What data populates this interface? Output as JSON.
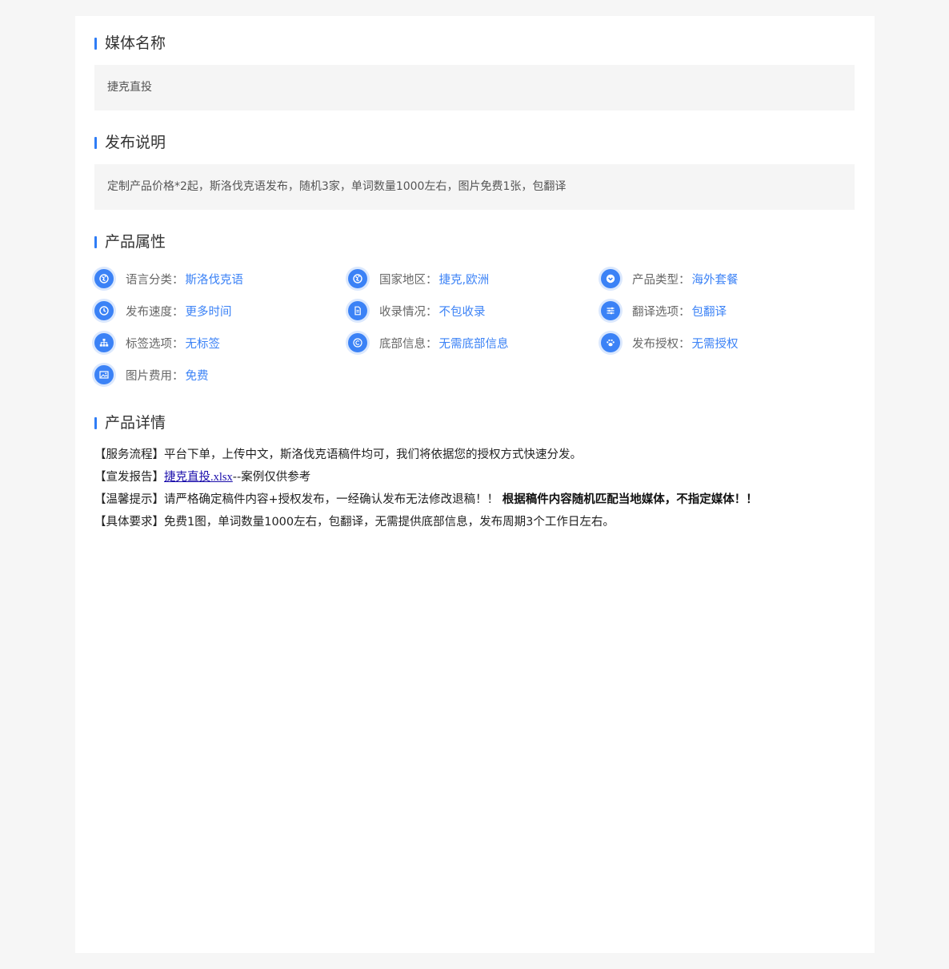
{
  "media_name": {
    "title": "媒体名称",
    "value": "捷克直投"
  },
  "publish_note": {
    "title": "发布说明",
    "value": "定制产品价格*2起，斯洛伐克语发布，随机3家，单词数量1000左右，图片免费1张，包翻译"
  },
  "attributes": {
    "title": "产品属性",
    "items": [
      {
        "icon": "globe-icon",
        "label": "语言分类：",
        "value": "斯洛伐克语"
      },
      {
        "icon": "globe-icon",
        "label": "国家地区：",
        "value": "捷克,欧洲"
      },
      {
        "icon": "chevron-down-icon",
        "label": "产品类型：",
        "value": "海外套餐"
      },
      {
        "icon": "clock-icon",
        "label": "发布速度：",
        "value": "更多时间"
      },
      {
        "icon": "document-icon",
        "label": "收录情况：",
        "value": "不包收录"
      },
      {
        "icon": "sliders-icon",
        "label": "翻译选项：",
        "value": "包翻译"
      },
      {
        "icon": "sitemap-icon",
        "label": "标签选项：",
        "value": "无标签"
      },
      {
        "icon": "copyright-icon",
        "label": "底部信息：",
        "value": "无需底部信息"
      },
      {
        "icon": "paw-icon",
        "label": "发布授权：",
        "value": "无需授权"
      },
      {
        "icon": "image-icon",
        "label": "图片费用：",
        "value": "免费"
      }
    ]
  },
  "details": {
    "title": "产品详情",
    "service_flow": "【服务流程】平台下单，上传中文，斯洛伐克语稿件均可，我们将依据您的授权方式快速分发。",
    "report_prefix": "【宣发报告】",
    "report_link": "捷克直投.xlsx",
    "report_suffix": "--案例仅供参考",
    "tip_prefix": "【温馨提示】请严格确定稿件内容+授权发布，一经确认发布无法修改退稿！！",
    "tip_bold": "根据稿件内容随机匹配当地媒体，不指定媒体！！",
    "requirements": "【具体要求】免费1图，单词数量1000左右，包翻译，无需提供底部信息，发布周期3个工作日左右。"
  }
}
